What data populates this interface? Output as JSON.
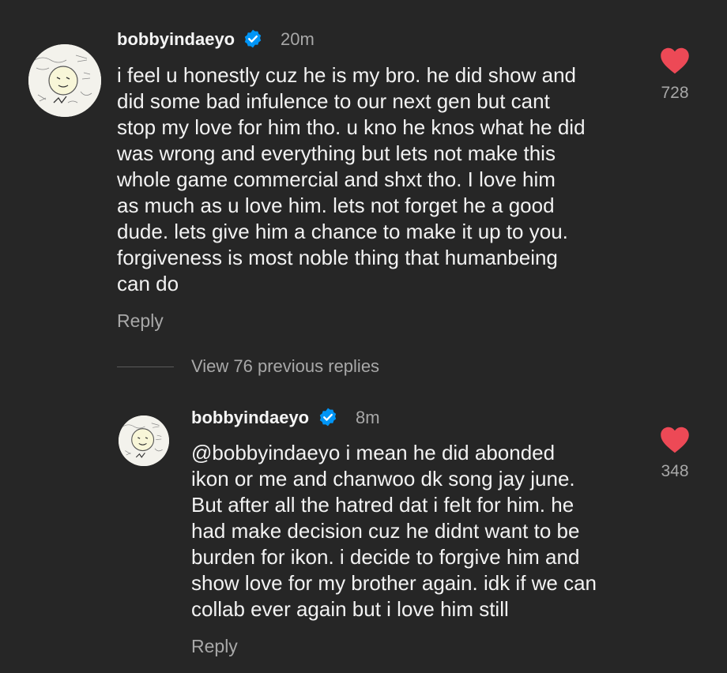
{
  "colors": {
    "background": "#262626",
    "heart": "#ed4956",
    "verified": "#0095f6",
    "muted": "#a8a8a8"
  },
  "comments": [
    {
      "username": "bobbyindaeyo",
      "time": "20m",
      "lines": [
        "i feel u honestly cuz he is my bro. he did show and",
        "did some bad infulence to our next gen but cant",
        "stop my love for him tho. u kno he knos what he did",
        "was wrong and everything but lets not make this",
        "whole game commercial and shxt tho. I love him",
        "as much as u love him. lets not forget he a good",
        "dude. lets give him a chance to make it up to you.",
        "forgiveness is most noble thing that humanbeing",
        "can do"
      ],
      "reply_label": "Reply",
      "likes": "728"
    }
  ],
  "view_replies_label": "View 76 previous replies",
  "replies": [
    {
      "username": "bobbyindaeyo",
      "time": "8m",
      "lines": [
        "@bobbyindaeyo i mean he did abonded",
        "ikon or me and chanwoo dk song jay  june.",
        "But after all the hatred dat i felt for him. he",
        "had make decision cuz he didnt want to be",
        "burden for ikon. i decide to forgive him and",
        "show love for my brother again. idk if we can",
        "collab ever again but i love him still"
      ],
      "reply_label": "Reply",
      "likes": "348"
    }
  ]
}
